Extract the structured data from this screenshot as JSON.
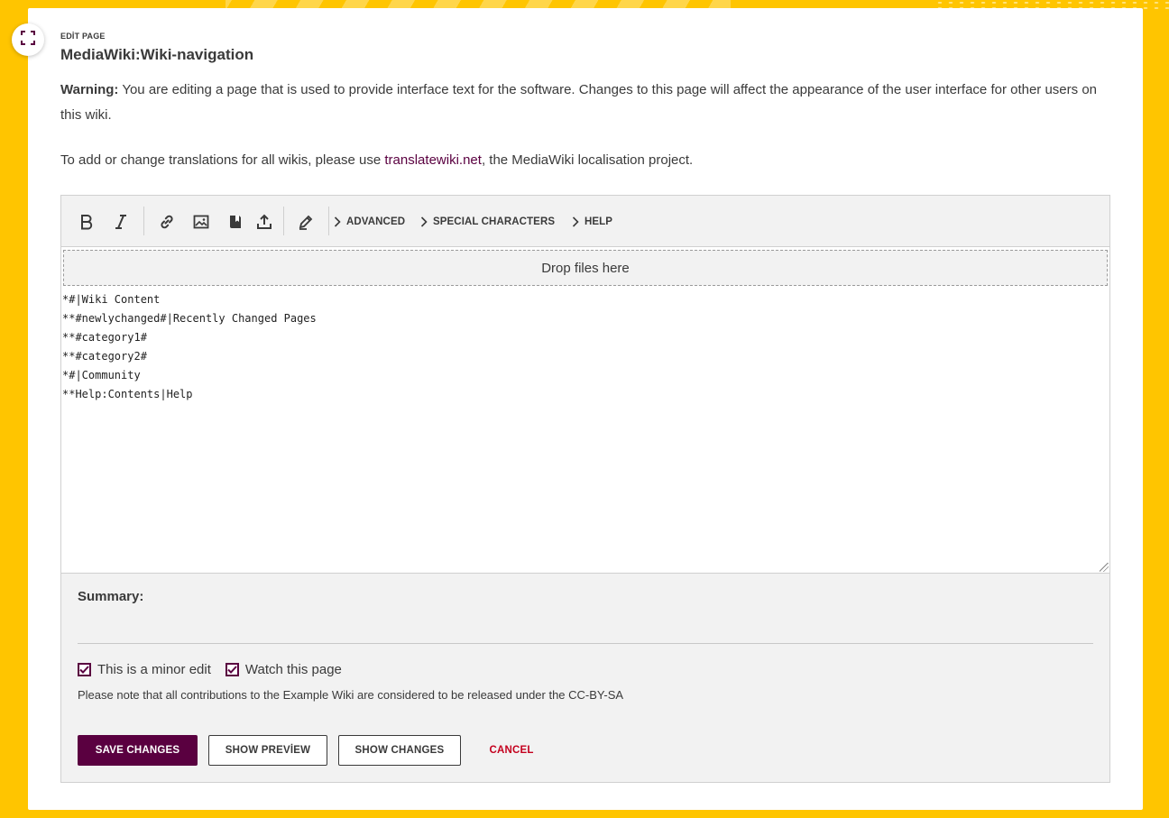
{
  "header": {
    "kicker": "EDİT PAGE",
    "title": "MediaWiki:Wiki-navigation"
  },
  "notice": {
    "warning_label": "Warning:",
    "warning_text": " You are editing a page that is used to provide interface text for the software. Changes to this page will affect the appearance of the user interface for other users on this wiki.",
    "translate_prefix": "To add or change translations for all wikis, please use ",
    "translate_link": "translatewiki.net",
    "translate_suffix": ", the MediaWiki localisation project."
  },
  "toolbar": {
    "menus": [
      "ADVANCED",
      "SPECIAL CHARACTERS",
      "HELP"
    ],
    "tools": [
      "bold-icon",
      "italic-icon",
      "link-icon",
      "image-icon",
      "reference-icon",
      "upload-icon",
      "pencil-icon"
    ]
  },
  "editor": {
    "dropzone": "Drop files here",
    "content": "*#|Wiki Content\n**#newlychanged#|Recently Changed Pages\n**#category1#\n**#category2#\n*#|Community\n**Help:Contents|Help"
  },
  "summary": {
    "label": "Summary:",
    "value": "",
    "minor_edit_label": "This is a minor edit",
    "minor_edit_checked": true,
    "watch_label": "Watch this page",
    "watch_checked": true,
    "license_text": "Please note that all contributions to the Example Wiki are considered to be released under the CC-BY-SA"
  },
  "actions": {
    "save": "SAVE CHANGES",
    "preview": "SHOW PREVİEW",
    "changes": "SHOW CHANGES",
    "cancel": "CANCEL"
  },
  "colors": {
    "background": "#ffc500",
    "primary": "#5a0040",
    "cancel": "#c4001e"
  }
}
